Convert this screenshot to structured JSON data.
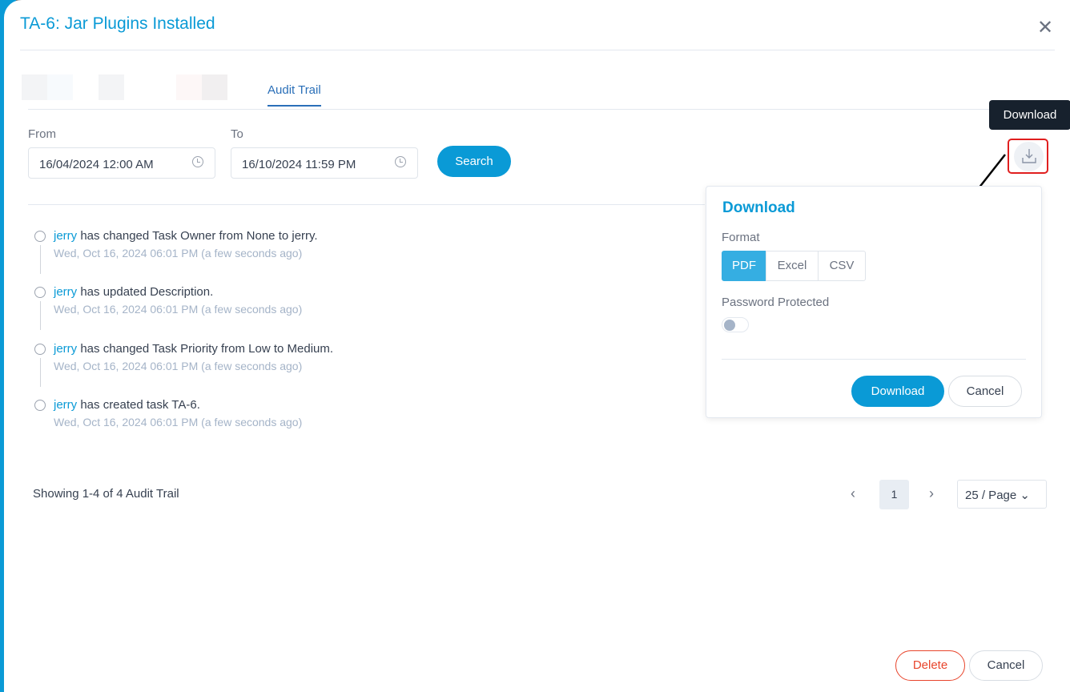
{
  "title": "TA-6: Jar Plugins Installed",
  "tabs": [
    {
      "label": "Audit Trail",
      "active": true
    }
  ],
  "filter": {
    "from_label": "From",
    "from_value": "16/04/2024 12:00 AM",
    "to_label": "To",
    "to_value": "16/10/2024 11:59 PM",
    "search_label": "Search"
  },
  "entries": [
    {
      "user": "jerry",
      "action": " has changed Task Owner from None to jerry.",
      "time": "Wed, Oct 16, 2024 06:01 PM (a few seconds ago)"
    },
    {
      "user": "jerry",
      "action": " has updated Description.",
      "time": "Wed, Oct 16, 2024 06:01 PM (a few seconds ago)"
    },
    {
      "user": "jerry",
      "action": " has changed Task Priority from Low to Medium.",
      "time": "Wed, Oct 16, 2024 06:01 PM (a few seconds ago)"
    },
    {
      "user": "jerry",
      "action": " has created task TA-6.",
      "time": "Wed, Oct 16, 2024 06:01 PM (a few seconds ago)"
    }
  ],
  "footer": {
    "showing": "Showing 1-4 of 4 Audit Trail",
    "page": "1",
    "page_size": "25 / Page"
  },
  "tooltip": "Download",
  "download": {
    "title": "Download",
    "format_label": "Format",
    "formats": [
      "PDF",
      "Excel",
      "CSV"
    ],
    "selected": "PDF",
    "password_label": "Password Protected",
    "password_enabled": false,
    "download_label": "Download",
    "cancel_label": "Cancel"
  },
  "actions": {
    "delete": "Delete",
    "cancel": "Cancel"
  },
  "colors": {
    "accent": "#0a9ad6",
    "danger": "#e8452c"
  }
}
